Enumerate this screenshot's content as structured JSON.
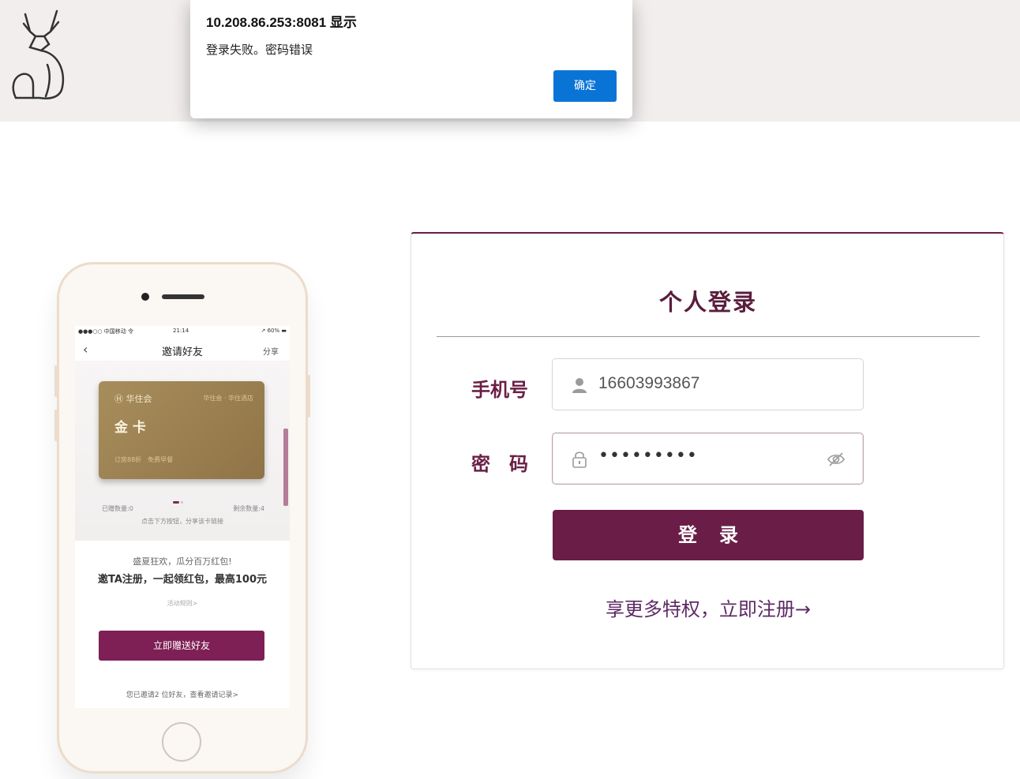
{
  "dialog": {
    "title": "10.208.86.253:8081 显示",
    "message": "登录失败。密码错误",
    "ok_label": "确定",
    "accent": "#0a74d6"
  },
  "header": {
    "logo_icon": "deer-logo-icon"
  },
  "phone_mockup": {
    "status_carrier": "●●●○○ 中国移动 令",
    "status_time": "21:14",
    "status_battery": "↗ 60% ▬",
    "nav_back_icon": "chevron-left-icon",
    "nav_title": "邀请好友",
    "nav_share": "分享",
    "card_brand": "Ⓗ 华住会",
    "card_sub": "华住会 · 华住酒店",
    "card_level": "金 卡",
    "card_perks": "订房88折　免费早餐",
    "stat_left": "已赠数量:0",
    "stat_right": "剩余数量:4",
    "stat_hint": "点击下方按钮，分享该卡链接",
    "promo_line1": "盛夏狂欢，瓜分百万红包!",
    "promo_line2": "邀TA注册，一起领红包，最高100元",
    "rules_link": "活动规则>",
    "invite_button": "立即赠送好友",
    "invited_text": "您已邀请2 位好友，查看邀请记录>"
  },
  "login": {
    "title": "个人登录",
    "phone_label": "手机号",
    "phone_value": "16603993867",
    "phone_icon": "user-icon",
    "password_label": "密　码",
    "password_value": "•••••••••",
    "password_icon": "lock-icon",
    "toggle_icon": "eye-off-icon",
    "submit_label": "登录",
    "register_link": "享更多特权，立即注册→",
    "brand_color": "#6a1d46"
  }
}
